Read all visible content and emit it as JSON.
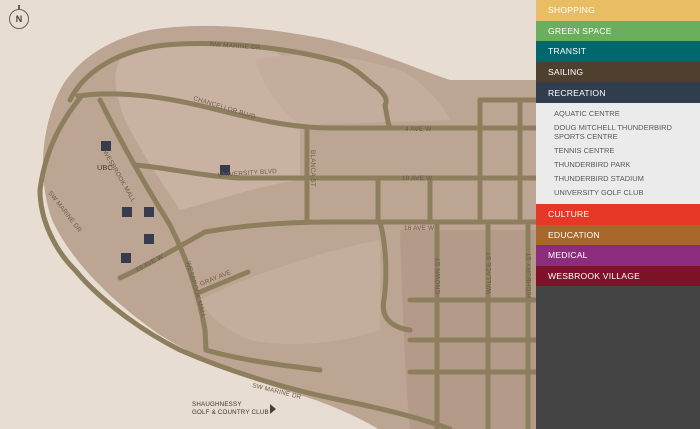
{
  "compass": {
    "label": "N"
  },
  "map": {
    "colors": {
      "background": "#e8ddd3",
      "land": "#bda594",
      "forest": "#c9b2a1",
      "road": "#8d7e5d",
      "building": "#363c4d"
    },
    "roads": {
      "nw_marine": "NW MARINE DR",
      "chancellor": "CHANCELLOR BLVD",
      "fourth": "4 AVE W",
      "university": "UNIVERSITY BLVD",
      "tenth": "10 AVE W",
      "blanca": "BLANCA ST",
      "sixteenth": "16 AVE W",
      "sw_marine_west": "SW MARINE DR",
      "wesbrook_north": "WESBROOK MALL",
      "wesbrook_south": "WESBROOK MALL",
      "sixteenth_west": "16 AVE W",
      "gray": "GRAY AVE",
      "crown": "CROWN ST",
      "wallace": "WALLACE ST",
      "highbury": "HIGHBURY ST",
      "sw_marine_south": "SW MARINE DR"
    },
    "places": {
      "ubc": "UBC"
    },
    "golf": {
      "line1": "SHAUGHNESSY",
      "line2": "GOLF & COUNTRY CLUB"
    }
  },
  "legend": {
    "categories": [
      {
        "label": "SHOPPING",
        "color": "#e8bd63"
      },
      {
        "label": "GREEN SPACE",
        "color": "#6aaf5d"
      },
      {
        "label": "TRANSIT",
        "color": "#00686a"
      },
      {
        "label": "SAILING",
        "color": "#4f3f2e"
      },
      {
        "label": "RECREATION",
        "color": "#2f3d4e"
      },
      {
        "label": "CULTURE",
        "color": "#e73727"
      },
      {
        "label": "EDUCATION",
        "color": "#a8672a"
      },
      {
        "label": "MEDICAL",
        "color": "#8c2c7d"
      },
      {
        "label": "WESBROOK VILLAGE",
        "color": "#7d1228"
      }
    ],
    "recreation_items": [
      "AQUATIC CENTRE",
      "DOUG MITCHELL THUNDERBIRD SPORTS CENTRE",
      "TENNIS CENTRE",
      "THUNDERBIRD PARK",
      "THUNDERBIRD STADIUM",
      "UNIVERSITY GOLF CLUB"
    ]
  }
}
